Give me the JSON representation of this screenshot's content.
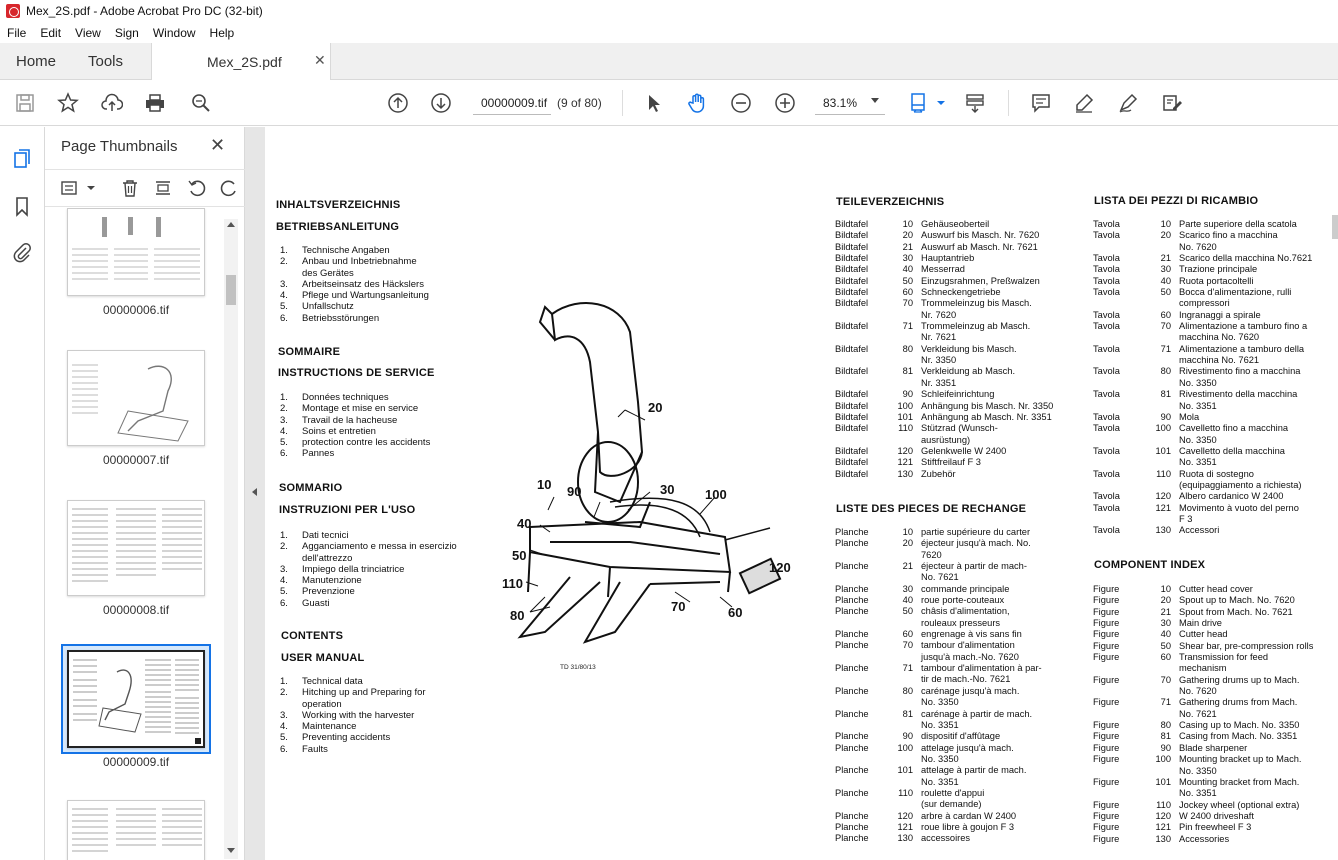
{
  "window": {
    "title": "Mex_2S.pdf - Adobe Acrobat Pro DC (32-bit)"
  },
  "menu": [
    "File",
    "Edit",
    "View",
    "Sign",
    "Window",
    "Help"
  ],
  "tabs": {
    "home": "Home",
    "tools": "Tools",
    "document": "Mex_2S.pdf",
    "close": "✕"
  },
  "toolbar": {
    "page_value": "00000009.tif",
    "page_of": "(9 of 80)",
    "zoom_value": "83.1%"
  },
  "panel": {
    "title": "Page Thumbnails",
    "close": "✕",
    "thumbnails": [
      {
        "label": "00000006.tif"
      },
      {
        "label": "00000007.tif"
      },
      {
        "label": "00000008.tif"
      },
      {
        "label": "00000009.tif",
        "selected": true
      },
      {
        "label": ""
      }
    ]
  },
  "document": {
    "de_heading": "INHALTSVERZEICHNIS",
    "de_subheading": "BETRIEBSANLEITUNG",
    "de_items": [
      {
        "n": "1.",
        "t": "Technische Angaben"
      },
      {
        "n": "2.",
        "t": "Anbau und Inbetriebnahme"
      },
      {
        "n": "",
        "t": "des Gerätes"
      },
      {
        "n": "3.",
        "t": "Arbeitseinsatz des Häckslers"
      },
      {
        "n": "4.",
        "t": "Pflege und Wartungsanleitung"
      },
      {
        "n": "5.",
        "t": "Unfallschutz"
      },
      {
        "n": "6.",
        "t": "Betriebsstörungen"
      }
    ],
    "fr_heading": "SOMMAIRE",
    "fr_subheading": "INSTRUCTIONS DE SERVICE",
    "fr_items": [
      {
        "n": "1.",
        "t": "Données techniques"
      },
      {
        "n": "2.",
        "t": "Montage et mise en service"
      },
      {
        "n": "3.",
        "t": "Travail de la hacheuse"
      },
      {
        "n": "4.",
        "t": "Soins et entretien"
      },
      {
        "n": "5.",
        "t": "protection contre les accidents"
      },
      {
        "n": "6.",
        "t": "Pannes"
      }
    ],
    "it_heading": "SOMMARIO",
    "it_subheading": "INSTRUZIONI PER L'USO",
    "it_items": [
      {
        "n": "1.",
        "t": "Dati tecnici"
      },
      {
        "n": "2.",
        "t": "Agganciamento e messa in esercizio"
      },
      {
        "n": "",
        "t": "dell'attrezzo"
      },
      {
        "n": "3.",
        "t": "Impiego della trinciatrice"
      },
      {
        "n": "4.",
        "t": "Manutenzione"
      },
      {
        "n": "5.",
        "t": "Prevenzione"
      },
      {
        "n": "6.",
        "t": "Guasti"
      }
    ],
    "en_heading": "CONTENTS",
    "en_subheading": "USER MANUAL",
    "en_items": [
      {
        "n": "1.",
        "t": "Technical data"
      },
      {
        "n": "2.",
        "t": "Hitching up and Preparing for"
      },
      {
        "n": "",
        "t": "operation"
      },
      {
        "n": "3.",
        "t": "Working with the harvester"
      },
      {
        "n": "4.",
        "t": "Maintenance"
      },
      {
        "n": "5.",
        "t": "Preventing accidents"
      },
      {
        "n": "6.",
        "t": "Faults"
      }
    ],
    "figure_code": "TD 31/80/13",
    "callouts": [
      "20",
      "10",
      "90",
      "30",
      "100",
      "40",
      "50",
      "110",
      "120",
      "80",
      "70",
      "60"
    ],
    "teile_heading": "TEILEVERZEICHNIS",
    "teile_rows": [
      [
        "Bildtafel",
        "10",
        "Gehäuseoberteil"
      ],
      [
        "Bildtafel",
        "20",
        "Auswurf bis Masch. Nr. 7620"
      ],
      [
        "Bildtafel",
        "21",
        "Auswurf ab Masch. Nr. 7621"
      ],
      [
        "Bildtafel",
        "30",
        "Hauptantrieb"
      ],
      [
        "Bildtafel",
        "40",
        "Messerrad"
      ],
      [
        "Bildtafel",
        "50",
        "Einzugsrahmen, Preßwalzen"
      ],
      [
        "Bildtafel",
        "60",
        "Schneckengetriebe"
      ],
      [
        "Bildtafel",
        "70",
        "Trommeleinzug bis Masch."
      ],
      [
        "",
        "",
        "Nr. 7620"
      ],
      [
        "Bildtafel",
        "71",
        "Trommeleinzug ab Masch."
      ],
      [
        "",
        "",
        "Nr. 7621"
      ],
      [
        "Bildtafel",
        "80",
        "Verkleidung bis Masch."
      ],
      [
        "",
        "",
        "Nr. 3350"
      ],
      [
        "Bildtafel",
        "81",
        "Verkleidung ab Masch."
      ],
      [
        "",
        "",
        "Nr. 3351"
      ],
      [
        "Bildtafel",
        "90",
        "Schleifeinrichtung"
      ],
      [
        "Bildtafel",
        "100",
        "Anhängung bis Masch. Nr. 3350"
      ],
      [
        "Bildtafel",
        "101",
        "Anhängung ab Masch. Nr. 3351"
      ],
      [
        "Bildtafel",
        "110",
        "Stützrad (Wunsch-"
      ],
      [
        "",
        "",
        "ausrüstung)"
      ],
      [
        "Bildtafel",
        "120",
        "Gelenkwelle W 2400"
      ],
      [
        "Bildtafel",
        "121",
        "Stiftfreilauf F 3"
      ],
      [
        "Bildtafel",
        "130",
        "Zubehör"
      ]
    ],
    "pieces_heading": "LISTE DES PIECES DE RECHANGE",
    "pieces_rows": [
      [
        "Planche",
        "10",
        "partie supérieure du carter"
      ],
      [
        "Planche",
        "20",
        "éjecteur jusqu'à mach. No."
      ],
      [
        "",
        "",
        "7620"
      ],
      [
        "Planche",
        "21",
        "éjecteur à partir de mach-"
      ],
      [
        "",
        "",
        "No. 7621"
      ],
      [
        "Planche",
        "30",
        "commande principale"
      ],
      [
        "Planche",
        "40",
        "roue porte-couteaux"
      ],
      [
        "Planche",
        "50",
        "châsis d'alimentation,"
      ],
      [
        "",
        "",
        "rouleaux presseurs"
      ],
      [
        "Planche",
        "60",
        "engrenage à vis sans fin"
      ],
      [
        "Planche",
        "70",
        "tambour d'alimentation"
      ],
      [
        "",
        "",
        "jusqu'à mach.-No. 7620"
      ],
      [
        "Planche",
        "71",
        "tambour d'alimentation à par-"
      ],
      [
        "",
        "",
        "tir de mach.-No. 7621"
      ],
      [
        "Planche",
        "80",
        "carénage jusqu'à mach."
      ],
      [
        "",
        "",
        "No. 3350"
      ],
      [
        "Planche",
        "81",
        "carénage à partir de mach."
      ],
      [
        "",
        "",
        "No. 3351"
      ],
      [
        "Planche",
        "90",
        "dispositif d'affûtage"
      ],
      [
        "Planche",
        "100",
        "attelage jusqu'à mach."
      ],
      [
        "",
        "",
        "No. 3350"
      ],
      [
        "Planche",
        "101",
        "attelage à partir de mach."
      ],
      [
        "",
        "",
        "No. 3351"
      ],
      [
        "Planche",
        "110",
        "roulette d'appui"
      ],
      [
        "",
        "",
        "(sur demande)"
      ],
      [
        "Planche",
        "120",
        "arbre à cardan W 2400"
      ],
      [
        "Planche",
        "121",
        "roue libre à goujon F 3"
      ],
      [
        "Planche",
        "130",
        "accessoires"
      ]
    ],
    "lista_heading": "LISTA DEI PEZZI DI RICAMBIO",
    "lista_rows": [
      [
        "Tavola",
        "10",
        "Parte superiore della scatola"
      ],
      [
        "Tavola",
        "20",
        "Scarico fino a macchina"
      ],
      [
        "",
        "",
        "No. 7620"
      ],
      [
        "Tavola",
        "21",
        "Scarico della macchina No.7621"
      ],
      [
        "Tavola",
        "30",
        "Trazione principale"
      ],
      [
        "Tavola",
        "40",
        "Ruota portacoltelli"
      ],
      [
        "Tavola",
        "50",
        "Bocca d'alimentazione, rulli"
      ],
      [
        "",
        "",
        "compressori"
      ],
      [
        "Tavola",
        "60",
        "Ingranaggi a spirale"
      ],
      [
        "Tavola",
        "70",
        "Alimentazione a tamburo fino a"
      ],
      [
        "",
        "",
        "macchina No. 7620"
      ],
      [
        "Tavola",
        "71",
        "Alimentazione a tamburo della"
      ],
      [
        "",
        "",
        "macchina No. 7621"
      ],
      [
        "Tavola",
        "80",
        "Rivestimento fino a macchina"
      ],
      [
        "",
        "",
        "No. 3350"
      ],
      [
        "Tavola",
        "81",
        "Rivestimento della macchina"
      ],
      [
        "",
        "",
        "No. 3351"
      ],
      [
        "Tavola",
        "90",
        "Mola"
      ],
      [
        "Tavola",
        "100",
        "Cavelletto fino a macchina"
      ],
      [
        "",
        "",
        "No. 3350"
      ],
      [
        "Tavola",
        "101",
        "Cavelletto della macchina"
      ],
      [
        "",
        "",
        "No. 3351"
      ],
      [
        "Tavola",
        "110",
        "Ruota di sostegno"
      ],
      [
        "",
        "",
        "(equipaggiamento a richiesta)"
      ],
      [
        "Tavola",
        "120",
        "Albero cardanico W 2400"
      ],
      [
        "Tavola",
        "121",
        "Movimento à vuoto del perno"
      ],
      [
        "",
        "",
        "F 3"
      ],
      [
        "Tavola",
        "130",
        "Accessori"
      ]
    ],
    "index_heading": "COMPONENT INDEX",
    "index_rows": [
      [
        "Figure",
        "10",
        "Cutter head cover"
      ],
      [
        "Figure",
        "20",
        "Spout up to Mach. No. 7620"
      ],
      [
        "Figure",
        "21",
        "Spout from Mach. No. 7621"
      ],
      [
        "Figure",
        "30",
        "Main drive"
      ],
      [
        "Figure",
        "40",
        "Cutter head"
      ],
      [
        "Figure",
        "50",
        "Shear bar, pre-compression rolls"
      ],
      [
        "Figure",
        "60",
        "Transmission for feed"
      ],
      [
        "",
        "",
        "mechanism"
      ],
      [
        "Figure",
        "70",
        "Gathering drums up to Mach."
      ],
      [
        "",
        "",
        "No. 7620"
      ],
      [
        "Figure",
        "71",
        "Gathering drums from Mach."
      ],
      [
        "",
        "",
        "No. 7621"
      ],
      [
        "Figure",
        "80",
        "Casing up to Mach. No. 3350"
      ],
      [
        "Figure",
        "81",
        "Casing from Mach. No. 3351"
      ],
      [
        "Figure",
        "90",
        "Blade sharpener"
      ],
      [
        "Figure",
        "100",
        "Mounting bracket up to Mach."
      ],
      [
        "",
        "",
        "No. 3350"
      ],
      [
        "Figure",
        "101",
        "Mounting bracket from Mach."
      ],
      [
        "",
        "",
        "No. 3351"
      ],
      [
        "Figure",
        "110",
        "Jockey wheel (optional extra)"
      ],
      [
        "Figure",
        "120",
        "W 2400 driveshaft"
      ],
      [
        "Figure",
        "121",
        "Pin freewheel F 3"
      ],
      [
        "Figure",
        "130",
        "Accessories"
      ]
    ]
  }
}
